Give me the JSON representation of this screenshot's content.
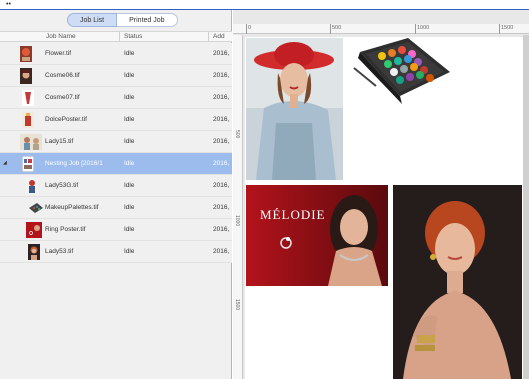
{
  "topbar": {
    "menu_glyph": "••"
  },
  "tabs": {
    "job_list": "Job List",
    "printed_job": "Printed Job"
  },
  "columns": {
    "name": "Job Name",
    "status": "Status",
    "added": "Add"
  },
  "jobs": [
    {
      "name": "Flower.tif",
      "status": "Idle",
      "added": "2016,"
    },
    {
      "name": "Cosme06.tif",
      "status": "Idle",
      "added": "2016,"
    },
    {
      "name": "Cosme07.tif",
      "status": "Idle",
      "added": "2016,"
    },
    {
      "name": "DolcePoster.tif",
      "status": "Idle",
      "added": "2016,"
    },
    {
      "name": "Lady15.tif",
      "status": "Idle",
      "added": "2016,"
    },
    {
      "name": "Nesting Job [2016/1",
      "status": "Idle",
      "added": "2016,"
    },
    {
      "name": "Lady53G.tif",
      "status": "Idle",
      "added": "2016,"
    },
    {
      "name": "MakeupPalettes.tif",
      "status": "Idle",
      "added": "2016,"
    },
    {
      "name": "Ring Poster.tif",
      "status": "Idle",
      "added": "2016,"
    },
    {
      "name": "Lady53.tif",
      "status": "Idle",
      "added": "2016,"
    }
  ],
  "selected_row": 5,
  "ruler": {
    "top": [
      "0",
      "500",
      "1000",
      "1500"
    ],
    "left": [
      "500",
      "1000",
      "1500"
    ]
  },
  "canvas": {
    "melodie_text": "MÉLODIE"
  },
  "colors": {
    "selection": "#9bbcec",
    "accent": "#2b63c9"
  }
}
